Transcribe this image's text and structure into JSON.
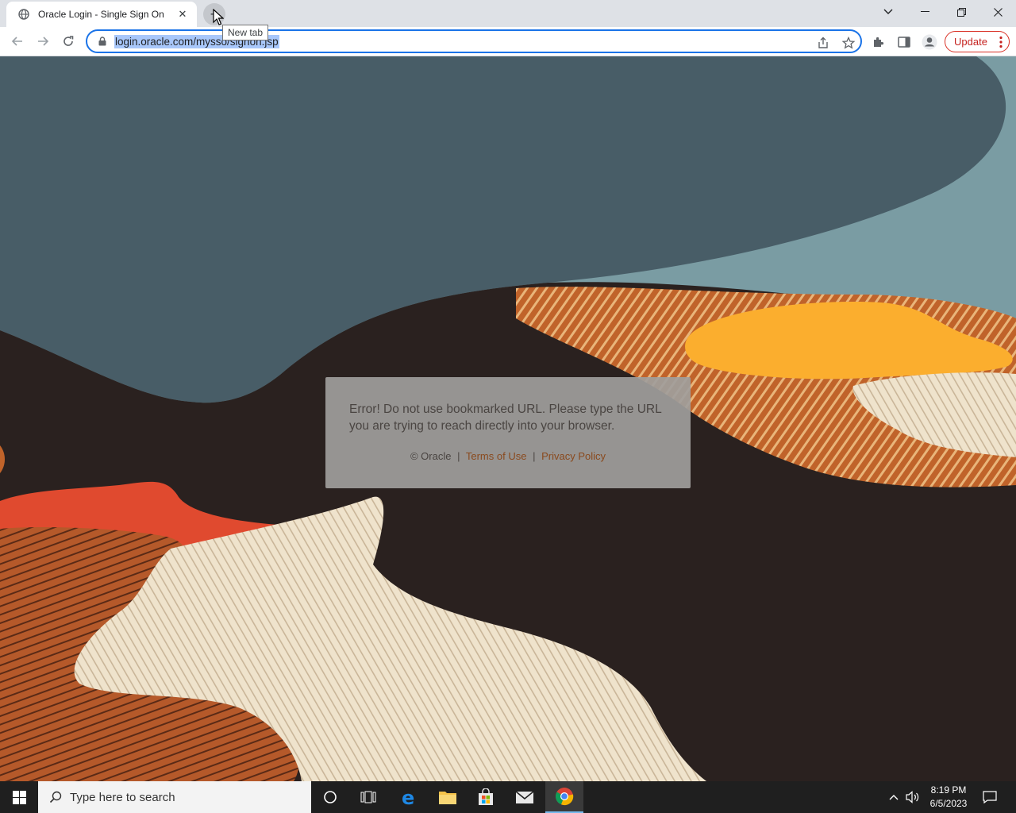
{
  "browser": {
    "tab": {
      "title": "Oracle Login - Single Sign On"
    },
    "tooltip": "New tab",
    "url": "login.oracle.com/mysso/signon.jsp",
    "update_label": "Update"
  },
  "page": {
    "error_message": "Error! Do not use bookmarked URL. Please type the URL you are trying to reach directly into your browser.",
    "copyright": "© Oracle",
    "separator": "|",
    "terms_link": "Terms of Use",
    "privacy_link": "Privacy Policy"
  },
  "taskbar": {
    "search_placeholder": "Type here to search",
    "time": "8:19 PM",
    "date": "6/5/2023"
  },
  "colors": {
    "sky_dark": "#485d67",
    "sky_light": "#7a9ca3",
    "ground": "#2a211f",
    "orange": "#c0632a",
    "yellow": "#fbae2e",
    "red": "#e04a2f",
    "cream": "#efe3cc",
    "link": "#8a4a1e",
    "omnibox_focus": "#1a73e8"
  }
}
